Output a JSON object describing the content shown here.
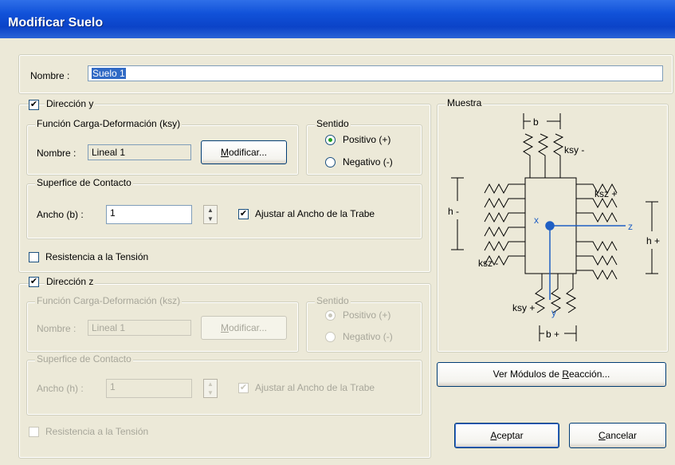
{
  "window": {
    "title": "Modificar Suelo"
  },
  "nombre": {
    "label": "Nombre :",
    "value": "Suelo 1"
  },
  "dir_y": {
    "checkbox_label": "Dirección y",
    "checked": true,
    "funcion": {
      "legend": "Función Carga-Deformación (ksy)",
      "nombre_label": "Nombre :",
      "nombre_value": "Lineal 1",
      "modificar_label": "Modificar...",
      "modificar_mnemonic": "M",
      "modificar_rest": "odificar..."
    },
    "sentido": {
      "legend": "Sentido",
      "positivo": "Positivo (+)",
      "negativo": "Negativo (-)",
      "selected": "positivo"
    },
    "superficie": {
      "legend": "Superfice de Contacto",
      "ancho_label": "Ancho (b) :",
      "ancho_value": "1",
      "ajustar_label": "Ajustar al Ancho de la Trabe",
      "ajustar_checked": true
    },
    "resistencia_label": "Resistencia a la Tensión",
    "resistencia_checked": false
  },
  "dir_z": {
    "checkbox_label": "Dirección z",
    "checked": true,
    "funcion": {
      "legend": "Función Carga-Deformación (ksz)",
      "nombre_label": "Nombre :",
      "nombre_value": "Lineal 1",
      "modificar_label": "Modificar...",
      "modificar_mnemonic": "M",
      "modificar_rest": "odificar..."
    },
    "sentido": {
      "legend": "Sentido",
      "positivo": "Positivo (+)",
      "negativo": "Negativo (-)",
      "selected": "positivo"
    },
    "superficie": {
      "legend": "Superfice de Contacto",
      "ancho_label": "Ancho (h) :",
      "ancho_value": "1",
      "ajustar_label": "Ajustar al Ancho de la Trabe",
      "ajustar_checked": true
    },
    "resistencia_label": "Resistencia a la Tensión",
    "resistencia_checked": false
  },
  "muestra": {
    "legend": "Muestra",
    "labels": {
      "b_top": "b",
      "ksy_minus": "ksy -",
      "ksz_plus": "ksz +",
      "h_minus": "h -",
      "h_plus": "h +",
      "x": "x",
      "z": "z",
      "y": "y",
      "ksz_minus": "ksz -",
      "ksy_plus": "ksy +",
      "b_bottom": "b +"
    }
  },
  "buttons": {
    "ver_modulos_pre": "Ver Módulos de ",
    "ver_modulos_mn": "R",
    "ver_modulos_post": "eacción...",
    "aceptar_mn": "A",
    "aceptar_rest": "ceptar",
    "cancelar_mn": "C",
    "cancelar_rest": "ancelar"
  },
  "colors": {
    "titlebar": "#0b43c8",
    "axis": "#1f5fc4",
    "selection": "#316ac5"
  }
}
